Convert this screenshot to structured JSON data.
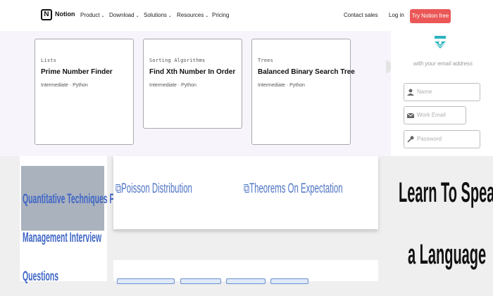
{
  "nav": {
    "logo_letter": "N",
    "brand": "Notion",
    "menu": [
      "Product",
      "Download",
      "Solutions",
      "Resources",
      "Pricing"
    ],
    "contact": "Contact sales",
    "login": "Log in",
    "cta": "Try Notion free"
  },
  "cards": [
    {
      "category": "Lists",
      "title": "Prime Number Finder",
      "meta": "Intermediate · Python"
    },
    {
      "category": "Sorting Algorithms",
      "title": "Find Xth Number In Order",
      "meta": "Intermediate · Python"
    },
    {
      "category": "Trees",
      "title": "Balanced Binary Search Tree",
      "meta": "Intermediate · Python"
    }
  ],
  "signup": {
    "hint": "with your email address",
    "name_placeholder": "Name",
    "email_placeholder": "Work Email",
    "password_placeholder": "Password"
  },
  "article": {
    "heading_lines": [
      "Quantitative Techniques For",
      "Management Interview",
      "Questions"
    ],
    "links": [
      "Poisson Distribution",
      "Theorems On Expectation"
    ]
  },
  "ad": {
    "lines": [
      "Learn To Speak",
      "a Language"
    ]
  },
  "colors": {
    "cta": "#eb5757",
    "link": "#4d74c4",
    "panel": "#f7f4fc",
    "icon_teal": "#2bb3c0"
  }
}
